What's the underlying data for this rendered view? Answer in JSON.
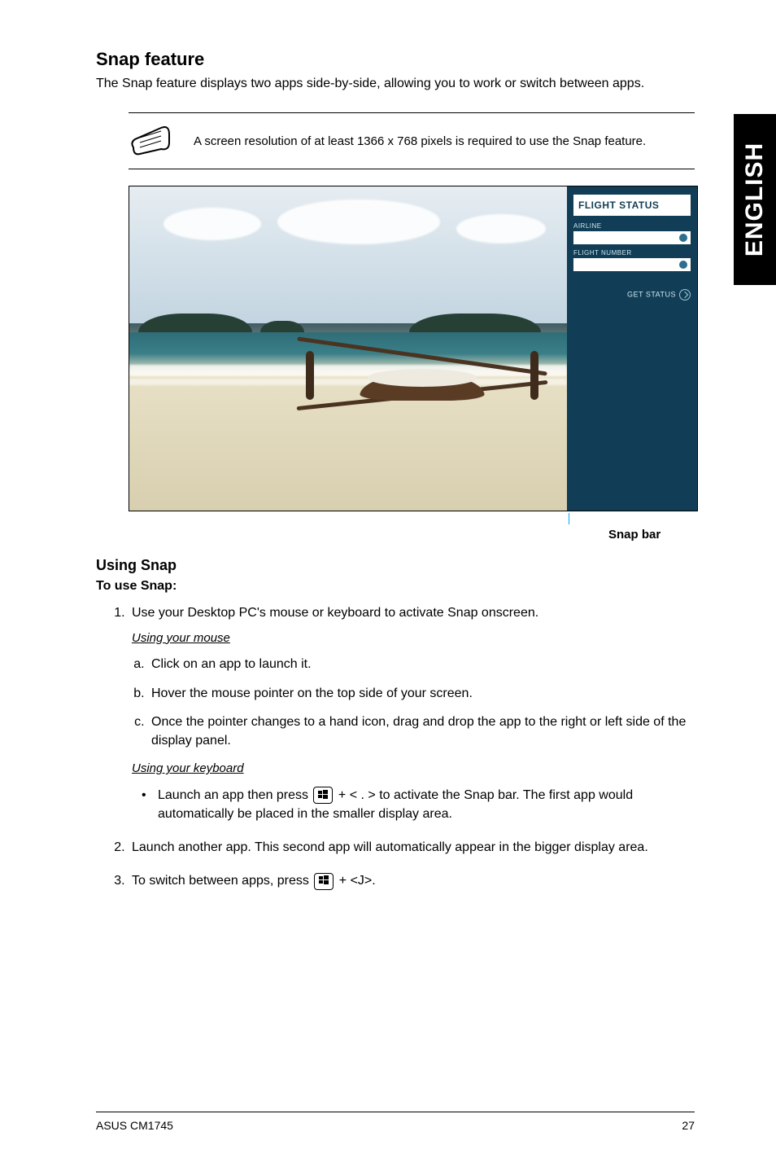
{
  "side_tab": "ENGLISH",
  "section_title": "Snap feature",
  "intro": "The Snap feature displays two apps side-by-side, allowing you to work or switch between apps.",
  "note_text": "A screen resolution of at least 1366 x 768 pixels is required to use the Snap feature.",
  "panel": {
    "header": "FLIGHT STATUS",
    "label1": "AIRLINE",
    "label2": "FLIGHT NUMBER",
    "button": "GET STATUS"
  },
  "snap_bar_label": "Snap bar",
  "using_snap_title": "Using Snap",
  "to_use_snap": "To use Snap:",
  "step1": "Use your Desktop PC's mouse or keyboard to activate Snap onscreen.",
  "mouse_heading": "Using your mouse",
  "mouse_a": "Click on an app to launch it.",
  "mouse_b": "Hover the mouse pointer on the top side of your screen.",
  "mouse_c": "Once the pointer changes to a hand icon, drag and drop the app to the right or left side of the display panel.",
  "kbd_heading": "Using your keyboard",
  "kbd_bullet_pre": "Launch an app then press ",
  "kbd_bullet_mid": " + < . > to activate the Snap bar. The first app would automatically be placed in the smaller display area.",
  "step2": "Launch another app. This second app will automatically appear in the bigger display area.",
  "step3_pre": "To switch between apps, press ",
  "step3_post": " + <J>.",
  "footer_left": "ASUS CM1745",
  "footer_right": "27"
}
